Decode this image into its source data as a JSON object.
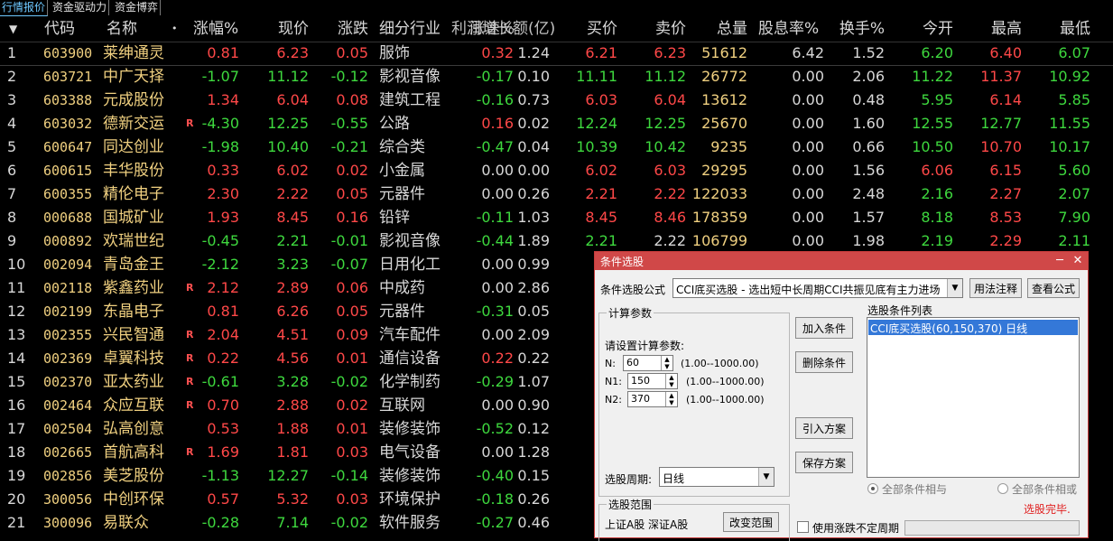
{
  "tabs": [
    "行情报价",
    "资金驱动力",
    "资金博弈"
  ],
  "header": {
    "sort_arrow": "▼",
    "code": "代码",
    "name": "名称",
    "name_dot": "•",
    "pct": "涨幅%",
    "price": "现价",
    "change": "涨跌",
    "industry": "细分行业",
    "speed_overlap": "利润增长额(亿)",
    "speed": "涨速%",
    "amount": "金额(亿)",
    "bid": "买价",
    "ask": "卖价",
    "volume": "总量",
    "dividend": "股息率%",
    "turnover": "换手%",
    "open": "今开",
    "high": "最高",
    "low": "最低"
  },
  "rows": [
    {
      "idx": "1",
      "code": "603900",
      "name": "莱绅通灵",
      "flag": "",
      "pct": "0.81",
      "price": "6.23",
      "change": "0.05",
      "industry": "服饰",
      "speed": "0.32",
      "amount": "1.24",
      "bid": "6.21",
      "ask": "6.23",
      "volume": "51612",
      "dividend": "6.42",
      "turnover": "1.52",
      "open": "6.20",
      "high": "6.40",
      "low": "6.07",
      "dir": "up",
      "speed_dir": "up",
      "bid_dir": "up",
      "ask_dir": "up",
      "open_dir": "dn",
      "high_dir": "up",
      "low_dir": "dn"
    },
    {
      "idx": "2",
      "code": "603721",
      "name": "中广天择",
      "flag": "",
      "pct": "-1.07",
      "price": "11.12",
      "change": "-0.12",
      "industry": "影视音像",
      "speed": "-0.17",
      "amount": "0.10",
      "bid": "11.11",
      "ask": "11.12",
      "volume": "26772",
      "dividend": "0.00",
      "turnover": "2.06",
      "open": "11.22",
      "high": "11.37",
      "low": "10.92",
      "dir": "dn",
      "speed_dir": "dn",
      "bid_dir": "dn",
      "ask_dir": "dn",
      "open_dir": "dn",
      "high_dir": "up",
      "low_dir": "dn"
    },
    {
      "idx": "3",
      "code": "603388",
      "name": "元成股份",
      "flag": "",
      "pct": "1.34",
      "price": "6.04",
      "change": "0.08",
      "industry": "建筑工程",
      "speed": "-0.16",
      "amount": "0.73",
      "bid": "6.03",
      "ask": "6.04",
      "volume": "13612",
      "dividend": "0.00",
      "turnover": "0.48",
      "open": "5.95",
      "high": "6.14",
      "low": "5.85",
      "dir": "up",
      "speed_dir": "dn",
      "bid_dir": "up",
      "ask_dir": "up",
      "open_dir": "dn",
      "high_dir": "up",
      "low_dir": "dn"
    },
    {
      "idx": "4",
      "code": "603032",
      "name": "德新交运",
      "flag": "R",
      "pct": "-4.30",
      "price": "12.25",
      "change": "-0.55",
      "industry": "公路",
      "speed": "0.16",
      "amount": "0.02",
      "bid": "12.24",
      "ask": "12.25",
      "volume": "25670",
      "dividend": "0.00",
      "turnover": "1.60",
      "open": "12.55",
      "high": "12.77",
      "low": "11.55",
      "dir": "dn",
      "speed_dir": "up",
      "bid_dir": "dn",
      "ask_dir": "dn",
      "open_dir": "dn",
      "high_dir": "dn",
      "low_dir": "dn"
    },
    {
      "idx": "5",
      "code": "600647",
      "name": "同达创业",
      "flag": "",
      "pct": "-1.98",
      "price": "10.40",
      "change": "-0.21",
      "industry": "综合类",
      "speed": "-0.47",
      "amount": "0.04",
      "bid": "10.39",
      "ask": "10.42",
      "volume": "9235",
      "dividend": "0.00",
      "turnover": "0.66",
      "open": "10.50",
      "high": "10.70",
      "low": "10.17",
      "dir": "dn",
      "speed_dir": "dn",
      "bid_dir": "dn",
      "ask_dir": "dn",
      "open_dir": "dn",
      "high_dir": "up",
      "low_dir": "dn"
    },
    {
      "idx": "6",
      "code": "600615",
      "name": "丰华股份",
      "flag": "",
      "pct": "0.33",
      "price": "6.02",
      "change": "0.02",
      "industry": "小金属",
      "speed": "0.00",
      "amount": "0.00",
      "bid": "6.02",
      "ask": "6.03",
      "volume": "29295",
      "dividend": "0.00",
      "turnover": "1.56",
      "open": "6.06",
      "high": "6.15",
      "low": "5.60",
      "dir": "up",
      "speed_dir": "eq",
      "bid_dir": "up",
      "ask_dir": "up",
      "open_dir": "up",
      "high_dir": "up",
      "low_dir": "dn"
    },
    {
      "idx": "7",
      "code": "600355",
      "name": "精伦电子",
      "flag": "",
      "pct": "2.30",
      "price": "2.22",
      "change": "0.05",
      "industry": "元器件",
      "speed": "0.00",
      "amount": "0.26",
      "bid": "2.21",
      "ask": "2.22",
      "volume": "122033",
      "dividend": "0.00",
      "turnover": "2.48",
      "open": "2.16",
      "high": "2.27",
      "low": "2.07",
      "dir": "up",
      "speed_dir": "eq",
      "bid_dir": "up",
      "ask_dir": "up",
      "open_dir": "dn",
      "high_dir": "up",
      "low_dir": "dn"
    },
    {
      "idx": "8",
      "code": "000688",
      "name": "国城矿业",
      "flag": "",
      "pct": "1.93",
      "price": "8.45",
      "change": "0.16",
      "industry": "铅锌",
      "speed": "-0.11",
      "amount": "1.03",
      "bid": "8.45",
      "ask": "8.46",
      "volume": "178359",
      "dividend": "0.00",
      "turnover": "1.57",
      "open": "8.18",
      "high": "8.53",
      "low": "7.90",
      "dir": "up",
      "speed_dir": "dn",
      "bid_dir": "up",
      "ask_dir": "up",
      "open_dir": "dn",
      "high_dir": "up",
      "low_dir": "dn"
    },
    {
      "idx": "9",
      "code": "000892",
      "name": "欢瑞世纪",
      "flag": "",
      "pct": "-0.45",
      "price": "2.21",
      "change": "-0.01",
      "industry": "影视音像",
      "speed": "-0.44",
      "amount": "1.89",
      "bid": "2.21",
      "ask": "2.22",
      "volume": "106799",
      "dividend": "0.00",
      "turnover": "1.98",
      "open": "2.19",
      "high": "2.29",
      "low": "2.11",
      "dir": "dn",
      "speed_dir": "dn",
      "bid_dir": "dn",
      "ask_dir": "eq",
      "open_dir": "dn",
      "high_dir": "up",
      "low_dir": "dn"
    },
    {
      "idx": "10",
      "code": "002094",
      "name": "青岛金王",
      "flag": "",
      "pct": "-2.12",
      "price": "3.23",
      "change": "-0.07",
      "industry": "日用化工",
      "speed": "0.00",
      "amount": "0.99",
      "dir": "dn",
      "speed_dir": "eq"
    },
    {
      "idx": "11",
      "code": "002118",
      "name": "紫鑫药业",
      "flag": "R",
      "pct": "2.12",
      "price": "2.89",
      "change": "0.06",
      "industry": "中成药",
      "speed": "0.00",
      "amount": "2.86",
      "dir": "up",
      "speed_dir": "eq"
    },
    {
      "idx": "12",
      "code": "002199",
      "name": "东晶电子",
      "flag": "",
      "pct": "0.81",
      "price": "6.26",
      "change": "0.05",
      "industry": "元器件",
      "speed": "-0.31",
      "amount": "0.05",
      "dir": "up",
      "speed_dir": "dn"
    },
    {
      "idx": "13",
      "code": "002355",
      "name": "兴民智通",
      "flag": "R",
      "pct": "2.04",
      "price": "4.51",
      "change": "0.09",
      "industry": "汽车配件",
      "speed": "0.00",
      "amount": "2.09",
      "dir": "up",
      "speed_dir": "eq"
    },
    {
      "idx": "14",
      "code": "002369",
      "name": "卓翼科技",
      "flag": "R",
      "pct": "0.22",
      "price": "4.56",
      "change": "0.01",
      "industry": "通信设备",
      "speed": "0.22",
      "amount": "0.22",
      "dir": "up",
      "speed_dir": "up"
    },
    {
      "idx": "15",
      "code": "002370",
      "name": "亚太药业",
      "flag": "R",
      "pct": "-0.61",
      "price": "3.28",
      "change": "-0.02",
      "industry": "化学制药",
      "speed": "-0.29",
      "amount": "1.07",
      "dir": "dn",
      "speed_dir": "dn"
    },
    {
      "idx": "16",
      "code": "002464",
      "name": "众应互联",
      "flag": "R",
      "pct": "0.70",
      "price": "2.88",
      "change": "0.02",
      "industry": "互联网",
      "speed": "0.00",
      "amount": "0.90",
      "dir": "up",
      "speed_dir": "eq"
    },
    {
      "idx": "17",
      "code": "002504",
      "name": "弘高创意",
      "flag": "",
      "pct": "0.53",
      "price": "1.88",
      "change": "0.01",
      "industry": "装修装饰",
      "speed": "-0.52",
      "amount": "0.12",
      "dir": "up",
      "speed_dir": "dn"
    },
    {
      "idx": "18",
      "code": "002665",
      "name": "首航高科",
      "flag": "R",
      "pct": "1.69",
      "price": "1.81",
      "change": "0.03",
      "industry": "电气设备",
      "speed": "0.00",
      "amount": "1.28",
      "dir": "up",
      "speed_dir": "eq"
    },
    {
      "idx": "19",
      "code": "002856",
      "name": "美芝股份",
      "flag": "",
      "pct": "-1.13",
      "price": "12.27",
      "change": "-0.14",
      "industry": "装修装饰",
      "speed": "-0.40",
      "amount": "0.15",
      "dir": "dn",
      "speed_dir": "dn"
    },
    {
      "idx": "20",
      "code": "300056",
      "name": "中创环保",
      "flag": "",
      "pct": "0.57",
      "price": "5.32",
      "change": "0.03",
      "industry": "环境保护",
      "speed": "-0.18",
      "amount": "0.26",
      "dir": "up",
      "speed_dir": "dn"
    },
    {
      "idx": "21",
      "code": "300096",
      "name": "易联众",
      "flag": "",
      "pct": "-0.28",
      "price": "7.14",
      "change": "-0.02",
      "industry": "软件服务",
      "speed": "-0.27",
      "amount": "0.46",
      "dir": "dn",
      "speed_dir": "dn"
    }
  ],
  "dialog": {
    "title": "条件选股",
    "min": "─",
    "close": "✕",
    "formula_label": "条件选股公式",
    "formula_value": "CCI底买选股  - 选出短中长周期CCI共振见底有主力进场",
    "usage_btn": "用法注释",
    "view_btn": "查看公式",
    "params_group": "计算参数",
    "params_prompt": "请设置计算参数:",
    "params": [
      {
        "label": "N:",
        "value": "60",
        "range": "(1.00--1000.00)"
      },
      {
        "label": "N1:",
        "value": "150",
        "range": "(1.00--1000.00)"
      },
      {
        "label": "N2:",
        "value": "370",
        "range": "(1.00--1000.00)"
      }
    ],
    "period_label": "选股周期:",
    "period_value": "日线",
    "add_btn": "加入条件",
    "del_btn": "删除条件",
    "import_btn": "引入方案",
    "save_btn": "保存方案",
    "list_label": "选股条件列表",
    "list_items": [
      "CCI底买选股(60,150,370) 日线"
    ],
    "radio_and": "全部条件相与",
    "radio_or": "全部条件相或",
    "done": "选股完毕.",
    "scope_group": "选股范围",
    "scope_value": "上证A股 深证A股",
    "change_scope_btn": "改变范围",
    "irregular_check": "使用涨跌不定周期"
  },
  "colors": {
    "up": "#ff4848",
    "down": "#3ed83e",
    "code": "#f0d080",
    "dialog_title": "#d04848"
  }
}
